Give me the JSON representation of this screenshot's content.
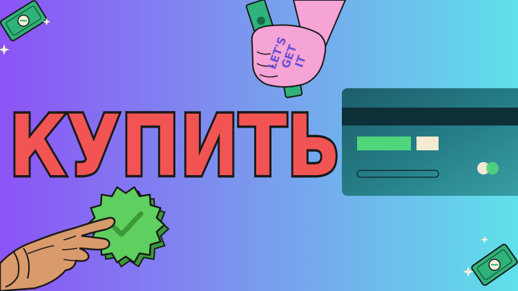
{
  "headline": {
    "text": "КУПИТЬ",
    "fill_color": "#f25454",
    "outline_color": "#1a1a1a"
  },
  "fist": {
    "line1": "LET'S",
    "line2": "GET",
    "line3": "IT",
    "skin_color": "#f6a3d6",
    "text_color": "#6a4fd6"
  },
  "colors": {
    "gradient_left": "#8b53f5",
    "gradient_mid": "#7a9bee",
    "gradient_right": "#5fe0ea",
    "card_dark": "#1d5d6b",
    "card_mid": "#26808a",
    "card_light": "#3aa0a6",
    "card_stripe": "#0f2f38",
    "card_green_bar": "#4fd67a",
    "card_cream_bar": "#f2ead2",
    "badge_green": "#5fcf5f",
    "money_green": "#2fb37a",
    "hand_skin": "#d99a6c",
    "outline": "#1a1a1a"
  },
  "icons": {
    "top_left": "money-bill-icon",
    "bottom_right": "money-bill-icon",
    "card": "credit-card-icon",
    "badge": "check-badge-icon",
    "pointing_hand": "pointing-hand-icon",
    "fist": "fist-holding-money-icon"
  }
}
